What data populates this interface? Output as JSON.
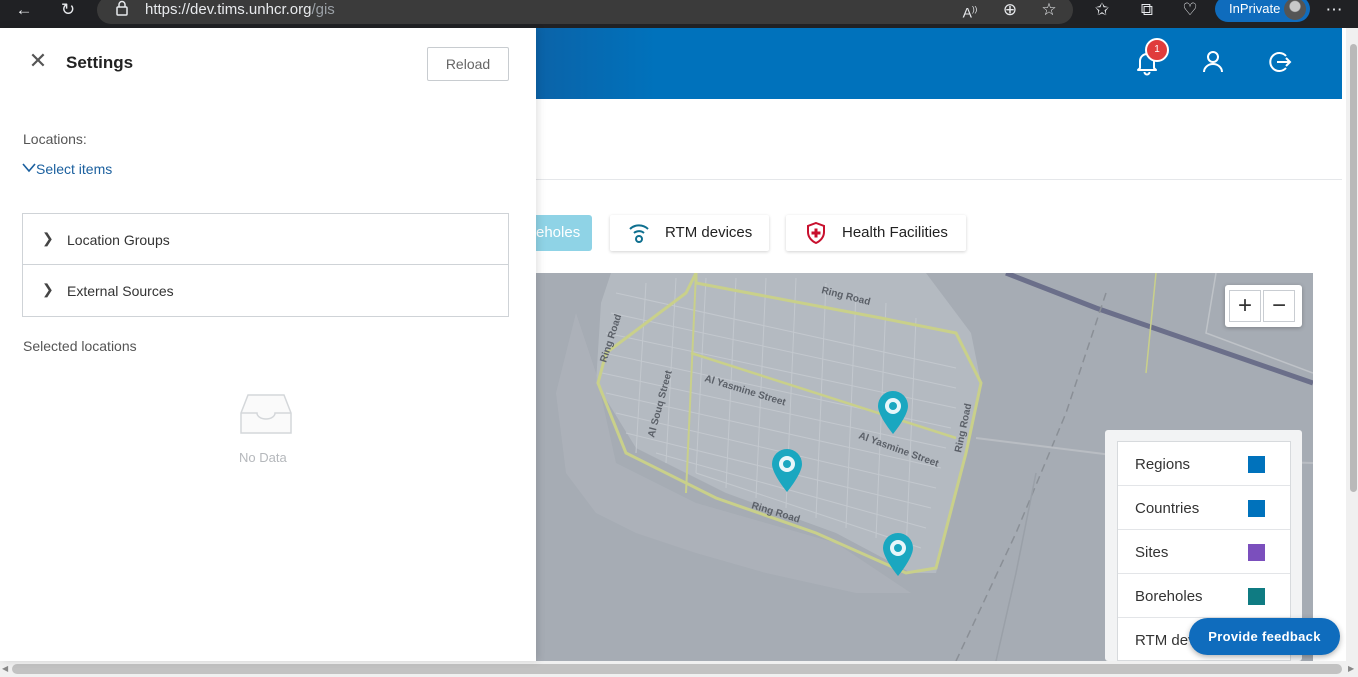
{
  "browser": {
    "url_host": "https://dev.tims.unhcr.org",
    "url_path": "/gis",
    "inprivate_label": "InPrivate"
  },
  "header": {
    "notification_count": "1"
  },
  "layers": {
    "boreholes_partial": "eholes",
    "rtm_devices": "RTM devices",
    "health_facilities": "Health Facilities"
  },
  "map": {
    "street_labels": [
      "Ring Road",
      "Ring Road",
      "Al Yasmine Street",
      "Al Yasmine Street",
      "Al Souq Street",
      "Ring Road",
      "Ring Road"
    ],
    "zoom_in": "+",
    "zoom_out": "−"
  },
  "legend": {
    "items": [
      {
        "label": "Regions",
        "color": "#0072bc"
      },
      {
        "label": "Countries",
        "color": "#0072bc"
      },
      {
        "label": "Sites",
        "color": "#7b4fbd"
      },
      {
        "label": "Boreholes",
        "color": "#0f7b82"
      },
      {
        "label": "RTM dev",
        "color": ""
      }
    ]
  },
  "feedback_label": "Provide feedback",
  "settings": {
    "title": "Settings",
    "reload_label": "Reload",
    "locations_label": "Locations:",
    "select_items_label": "Select items",
    "accordion": [
      {
        "label": "Location Groups"
      },
      {
        "label": "External Sources"
      }
    ],
    "selected_locations_label": "Selected locations",
    "no_data_label": "No Data"
  },
  "colors": {
    "brand_blue": "#0072bc",
    "map_marker": "#1aa7c0",
    "health_red": "#c8102e"
  }
}
